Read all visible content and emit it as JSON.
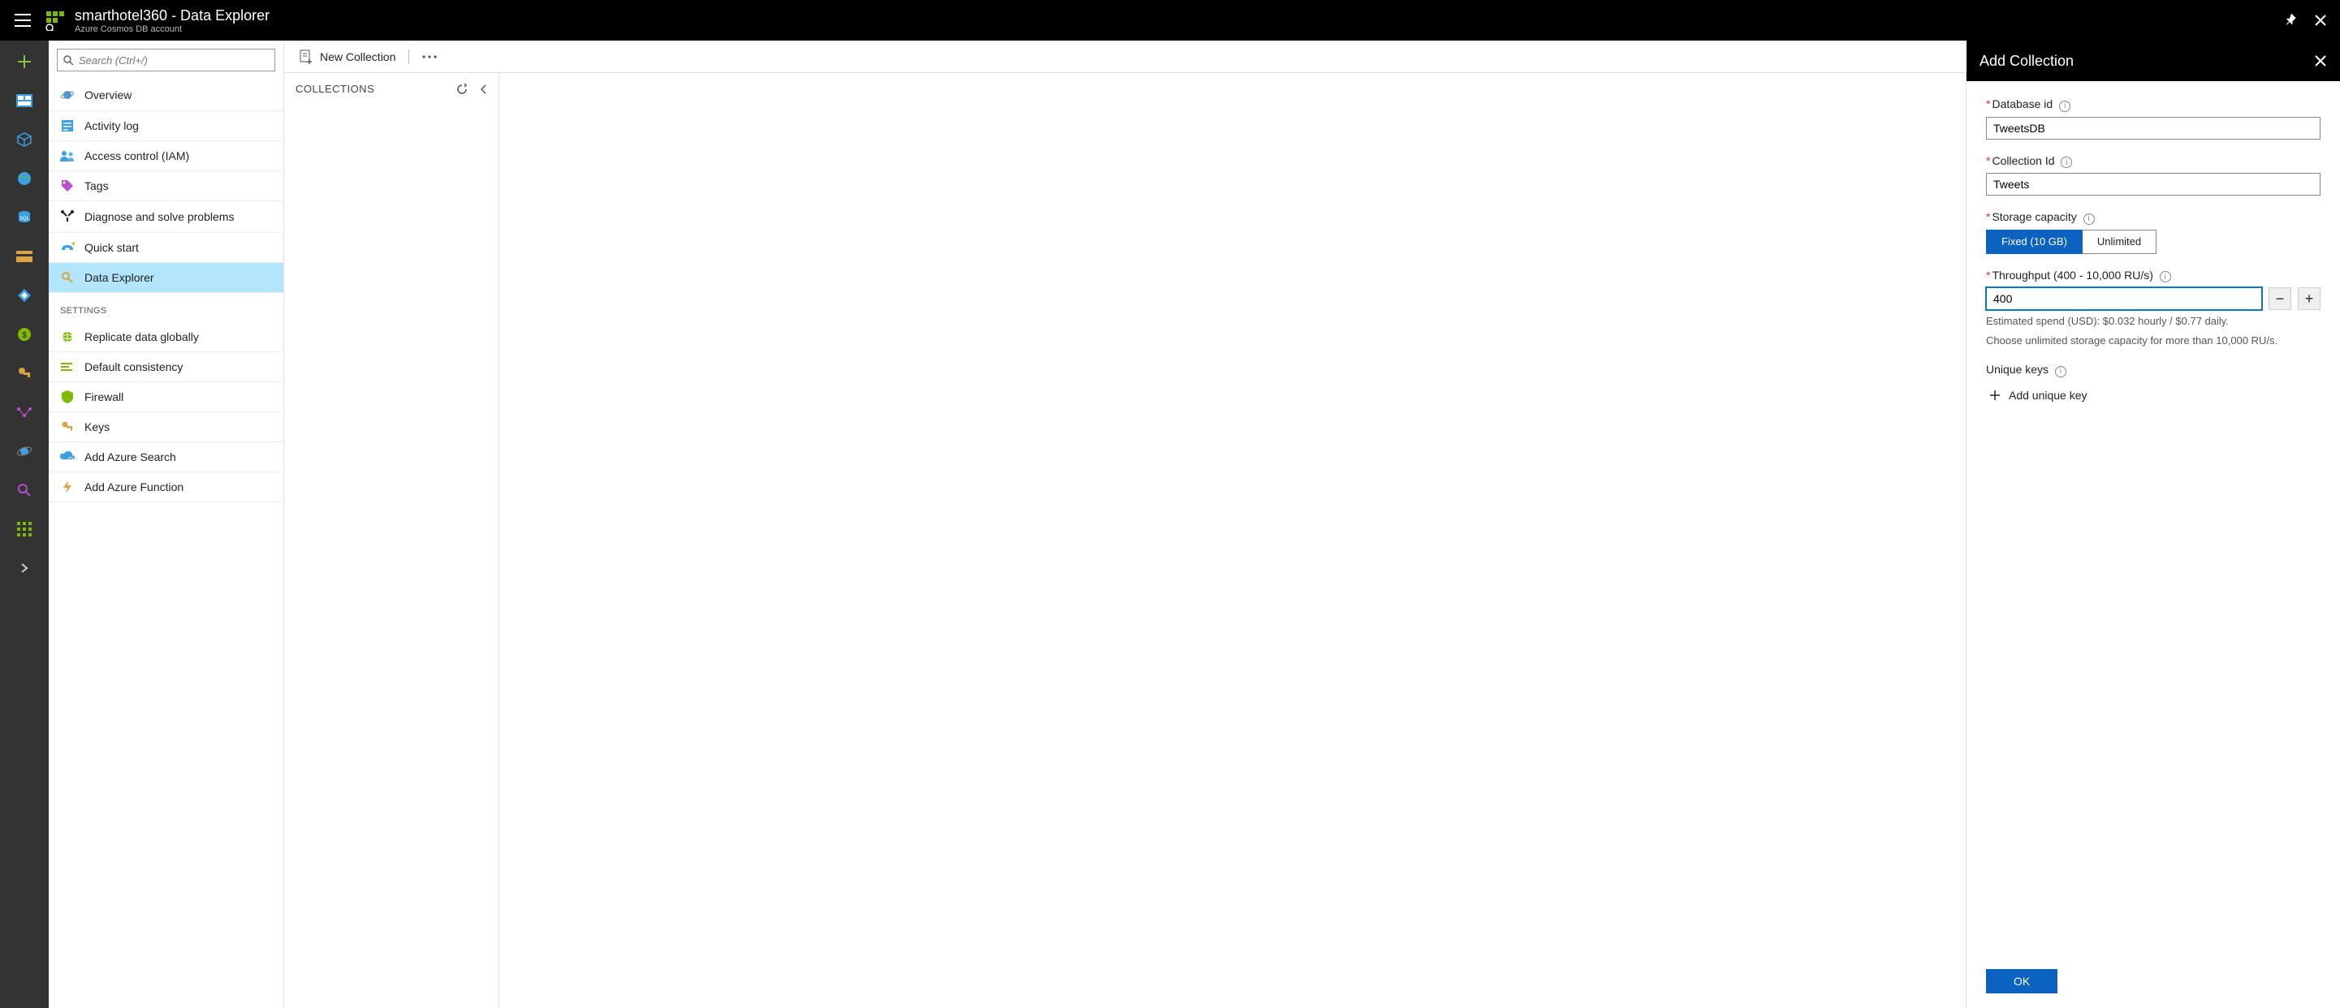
{
  "header": {
    "title": "smarthotel360 - Data Explorer",
    "subtitle": "Azure Cosmos DB account"
  },
  "search": {
    "placeholder": "Search (Ctrl+/)"
  },
  "nav": {
    "items": [
      {
        "label": "Overview"
      },
      {
        "label": "Activity log"
      },
      {
        "label": "Access control (IAM)"
      },
      {
        "label": "Tags"
      },
      {
        "label": "Diagnose and solve problems"
      },
      {
        "label": "Quick start"
      },
      {
        "label": "Data Explorer"
      }
    ],
    "settings_header": "SETTINGS",
    "settings": [
      {
        "label": "Replicate data globally"
      },
      {
        "label": "Default consistency"
      },
      {
        "label": "Firewall"
      },
      {
        "label": "Keys"
      },
      {
        "label": "Add Azure Search"
      },
      {
        "label": "Add Azure Function"
      }
    ]
  },
  "toolbar": {
    "new_collection": "New Collection"
  },
  "collections": {
    "header": "COLLECTIONS"
  },
  "panel": {
    "title": "Add Collection",
    "database_label": "Database id",
    "database_value": "TweetsDB",
    "collection_label": "Collection Id",
    "collection_value": "Tweets",
    "storage_label": "Storage capacity",
    "storage_fixed": "Fixed (10 GB)",
    "storage_unlimited": "Unlimited",
    "throughput_label": "Throughput (400 - 10,000 RU/s)",
    "throughput_value": "400",
    "estimate": "Estimated spend (USD): $0.032 hourly / $0.77 daily.",
    "estimate2": "Choose unlimited storage capacity for more than 10,000 RU/s.",
    "unique_label": "Unique keys",
    "add_unique": "Add unique key",
    "ok": "OK"
  }
}
